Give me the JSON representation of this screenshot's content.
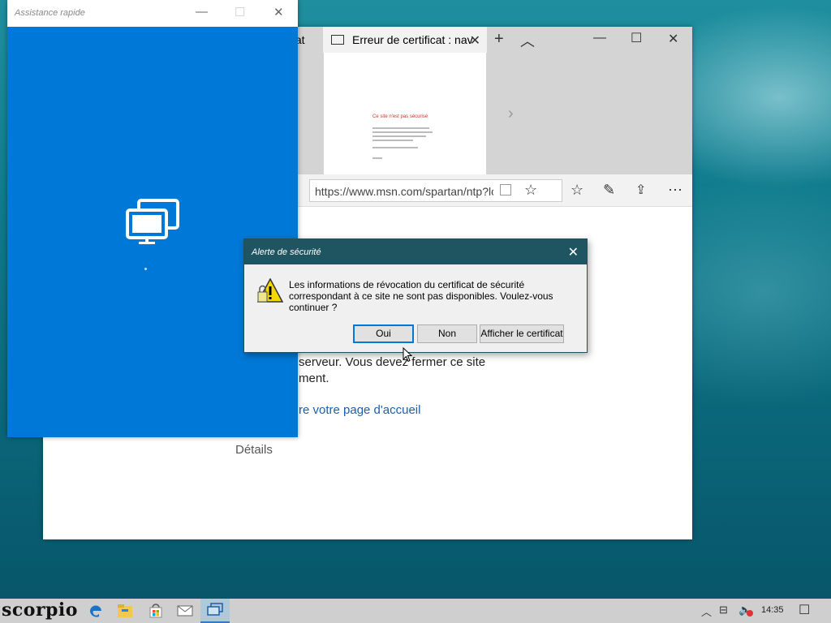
{
  "browser": {
    "prev_tab_label": "igat",
    "active_tab_title": "Erreur de certificat : nav",
    "preview": {
      "title": "Ce site n'est pas sécurisé"
    },
    "url": "https://www.msn.com/spartan/ntp?loc",
    "url_fragment": "t",
    "page": {
      "line1": "serveur. Vous devez fermer ce site",
      "line2": "ment.",
      "link": "re votre page d'accueil",
      "details": "Détails"
    }
  },
  "quick_assist": {
    "title": "Assistance rapide"
  },
  "dialog": {
    "title": "Alerte de sécurité",
    "message": "Les informations de révocation du certificat de sécurité correspondant à ce site ne sont pas disponibles. Voulez-vous continuer ?",
    "buttons": {
      "yes": "Oui",
      "no": "Non",
      "view_cert": "Afficher le certificat"
    }
  },
  "taskbar": {
    "logo": "scorpio",
    "clock": "14:35",
    "apps": [
      "edge-icon",
      "file-explorer-icon",
      "store-icon",
      "mail-icon",
      "quick-assist-icon"
    ]
  },
  "colors": {
    "quick_assist_bg": "#0078d7",
    "dialog_titlebar": "#1f5561",
    "link": "#1a5fa8"
  }
}
